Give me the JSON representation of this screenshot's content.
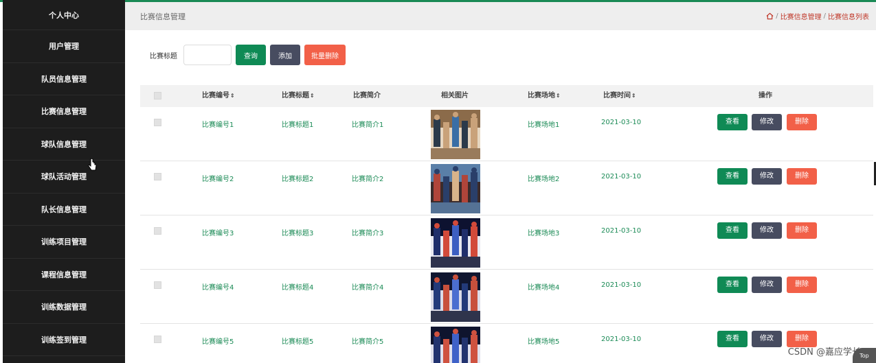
{
  "sidebar": {
    "items": [
      {
        "label": "个人中心"
      },
      {
        "label": "用户管理"
      },
      {
        "label": "队员信息管理"
      },
      {
        "label": "比赛信息管理"
      },
      {
        "label": "球队信息管理"
      },
      {
        "label": "球队活动管理"
      },
      {
        "label": "队长信息管理"
      },
      {
        "label": "训练项目管理"
      },
      {
        "label": "课程信息管理"
      },
      {
        "label": "训练数据管理"
      },
      {
        "label": "训练签到管理"
      }
    ]
  },
  "header": {
    "title": "比赛信息管理",
    "breadcrumb": [
      "比赛信息管理",
      "比赛信息列表"
    ],
    "breadcrumb_sep": "/"
  },
  "toolbar": {
    "search_label": "比赛标题",
    "search_value": "",
    "query_label": "查询",
    "add_label": "添加",
    "batch_delete_label": "批量删除"
  },
  "table": {
    "columns": [
      "比赛编号",
      "比赛标题",
      "比赛简介",
      "相关图片",
      "比赛场地",
      "比赛时间",
      "操作"
    ],
    "sortable_marker": "⇕",
    "rows": [
      {
        "id": "比赛编号1",
        "title": "比赛标题1",
        "intro": "比赛简介1",
        "venue": "比赛场地1",
        "time": "2021-03-10"
      },
      {
        "id": "比赛编号2",
        "title": "比赛标题2",
        "intro": "比赛简介2",
        "venue": "比赛场地2",
        "time": "2021-03-10"
      },
      {
        "id": "比赛编号3",
        "title": "比赛标题3",
        "intro": "比赛简介3",
        "venue": "比赛场地3",
        "time": "2021-03-10"
      },
      {
        "id": "比赛编号4",
        "title": "比赛标题4",
        "intro": "比赛简介4",
        "venue": "比赛场地4",
        "time": "2021-03-10"
      },
      {
        "id": "比赛编号5",
        "title": "比赛标题5",
        "intro": "比赛简介5",
        "venue": "比赛场地5",
        "time": "2021-03-10"
      }
    ],
    "actions": {
      "view": "查看",
      "edit": "修改",
      "delete": "删除"
    }
  },
  "watermark": "CSDN @嘉应学长",
  "top_button": "Top",
  "colors": {
    "accent_green": "#0f8a55",
    "navy": "#474c60",
    "danger": "#f26048",
    "sidebar_bg": "#1d1d1d",
    "breadcrumb_red": "#c0392b"
  }
}
